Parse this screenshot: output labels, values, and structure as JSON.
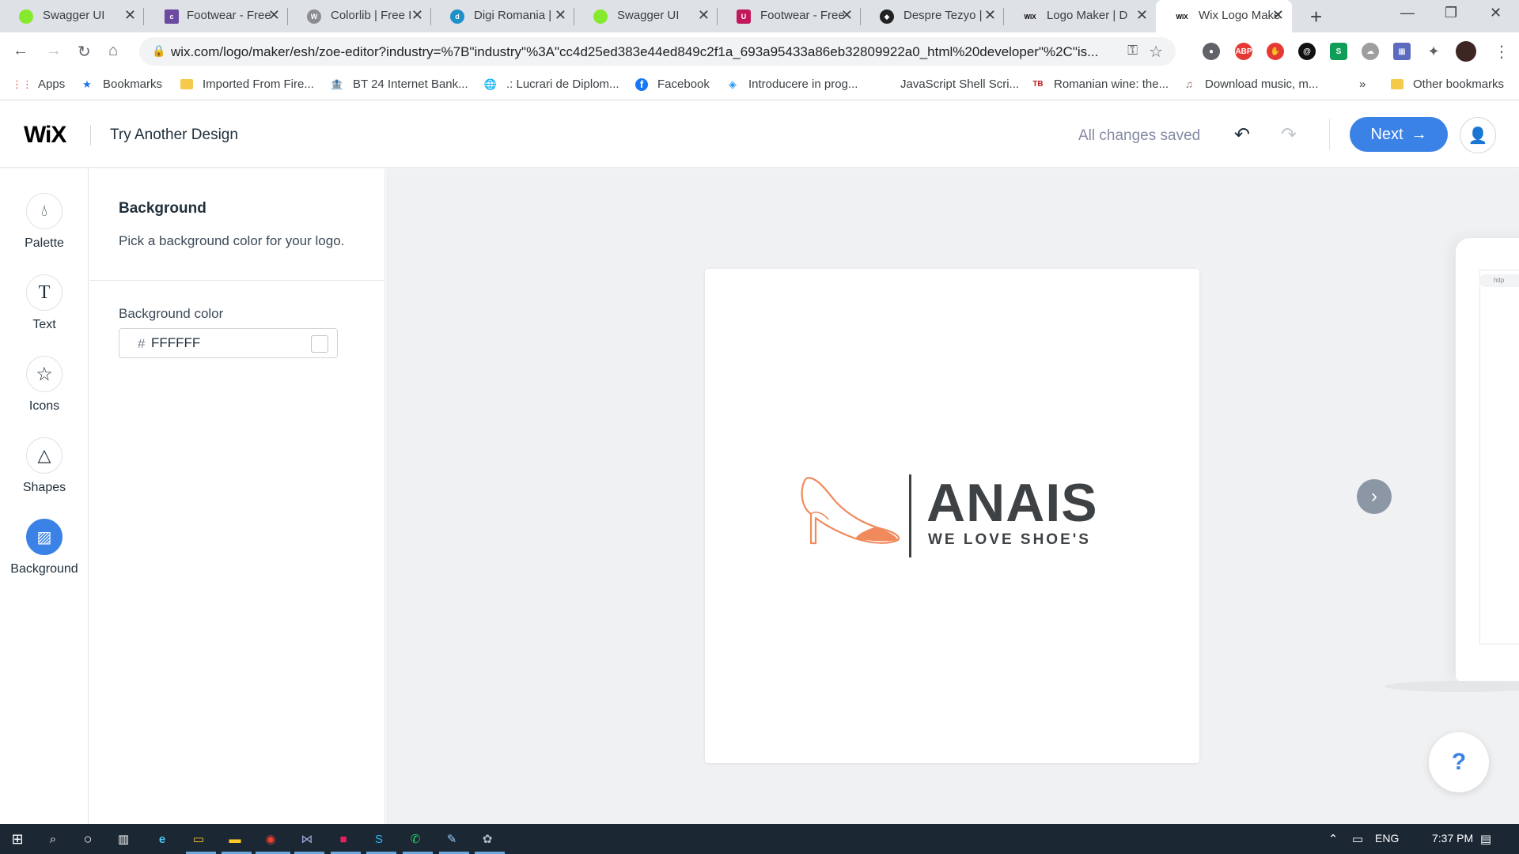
{
  "browser": {
    "tabs": [
      {
        "title": "Swagger UI",
        "favicon_color": "#85ea2d",
        "favicon_text": "",
        "active": false
      },
      {
        "title": "Footwear - Free",
        "favicon_color": "#6b4aa0",
        "favicon_text": "c",
        "active": false
      },
      {
        "title": "Colorlib | Free I",
        "favicon_color": "#8a8d91",
        "favicon_text": "W",
        "active": false
      },
      {
        "title": "Digi Romania |",
        "favicon_color": "#1e90c8",
        "favicon_text": "d",
        "active": false
      },
      {
        "title": "Swagger UI",
        "favicon_color": "#85ea2d",
        "favicon_text": "",
        "active": false
      },
      {
        "title": "Footwear - Free",
        "favicon_color": "#c2185b",
        "favicon_text": "U",
        "active": false
      },
      {
        "title": "Despre Tezyo |",
        "favicon_color": "#222222",
        "favicon_text": "◆",
        "active": false
      },
      {
        "title": "Logo Maker | D",
        "favicon_color": "#000000",
        "favicon_text": "WIX",
        "active": false
      },
      {
        "title": "Wix Logo Make",
        "favicon_color": "#000000",
        "favicon_text": "WIX",
        "active": true
      }
    ],
    "new_tab_icon": "+",
    "url": "wix.com/logo/maker/esh/zoe-editor?industry=%7B\"industry\"%3A\"cc4d25ed383e44ed849c2f1a_693a95433a86eb32809922a0_html%20developer\"%2C\"is...",
    "bookmarks": [
      {
        "label": "Apps",
        "icon": "apps-grid-icon"
      },
      {
        "label": "Bookmarks",
        "icon": "star-icon"
      },
      {
        "label": "Imported From Fire...",
        "icon": "folder-icon"
      },
      {
        "label": "BT 24 Internet Bank...",
        "icon": "bank-icon"
      },
      {
        "label": ".: Lucrari de Diplom...",
        "icon": "globe-icon"
      },
      {
        "label": "Facebook",
        "icon": "facebook-icon"
      },
      {
        "label": "Introducere in prog...",
        "icon": "code-icon"
      },
      {
        "label": "JavaScript Shell Scri...",
        "icon": "none"
      },
      {
        "label": "Romanian wine: the...",
        "icon": "wine-icon"
      },
      {
        "label": "Download music, m...",
        "icon": "music-icon"
      }
    ],
    "more_bookmarks": "»",
    "other_bookmarks": "Other bookmarks"
  },
  "header": {
    "logo": "WiX",
    "title": "Try Another Design",
    "status": "All changes saved",
    "next_label": "Next"
  },
  "rail": {
    "items": [
      {
        "label": "Palette",
        "icon": "palette-drop-icon",
        "active": false
      },
      {
        "label": "Text",
        "icon": "text-icon",
        "active": false
      },
      {
        "label": "Icons",
        "icon": "star-icon",
        "active": false
      },
      {
        "label": "Shapes",
        "icon": "shapes-icon",
        "active": false
      },
      {
        "label": "Background",
        "icon": "background-hatch-icon",
        "active": true
      }
    ]
  },
  "panel": {
    "title": "Background",
    "subtitle": "Pick a background color for your logo.",
    "field_label": "Background color",
    "hash": "#",
    "color_value": "FFFFFF",
    "swatch_color": "#FFFFFF"
  },
  "logo": {
    "brand": "ANAIS",
    "tagline": "WE LOVE SHOE'S",
    "shoe_color": "#f08a5d",
    "text_color": "#3f4245"
  },
  "canvas": {
    "help_label": "?",
    "mockup_url": "http"
  },
  "taskbar": {
    "language": "ENG",
    "time": "7:37 PM"
  }
}
